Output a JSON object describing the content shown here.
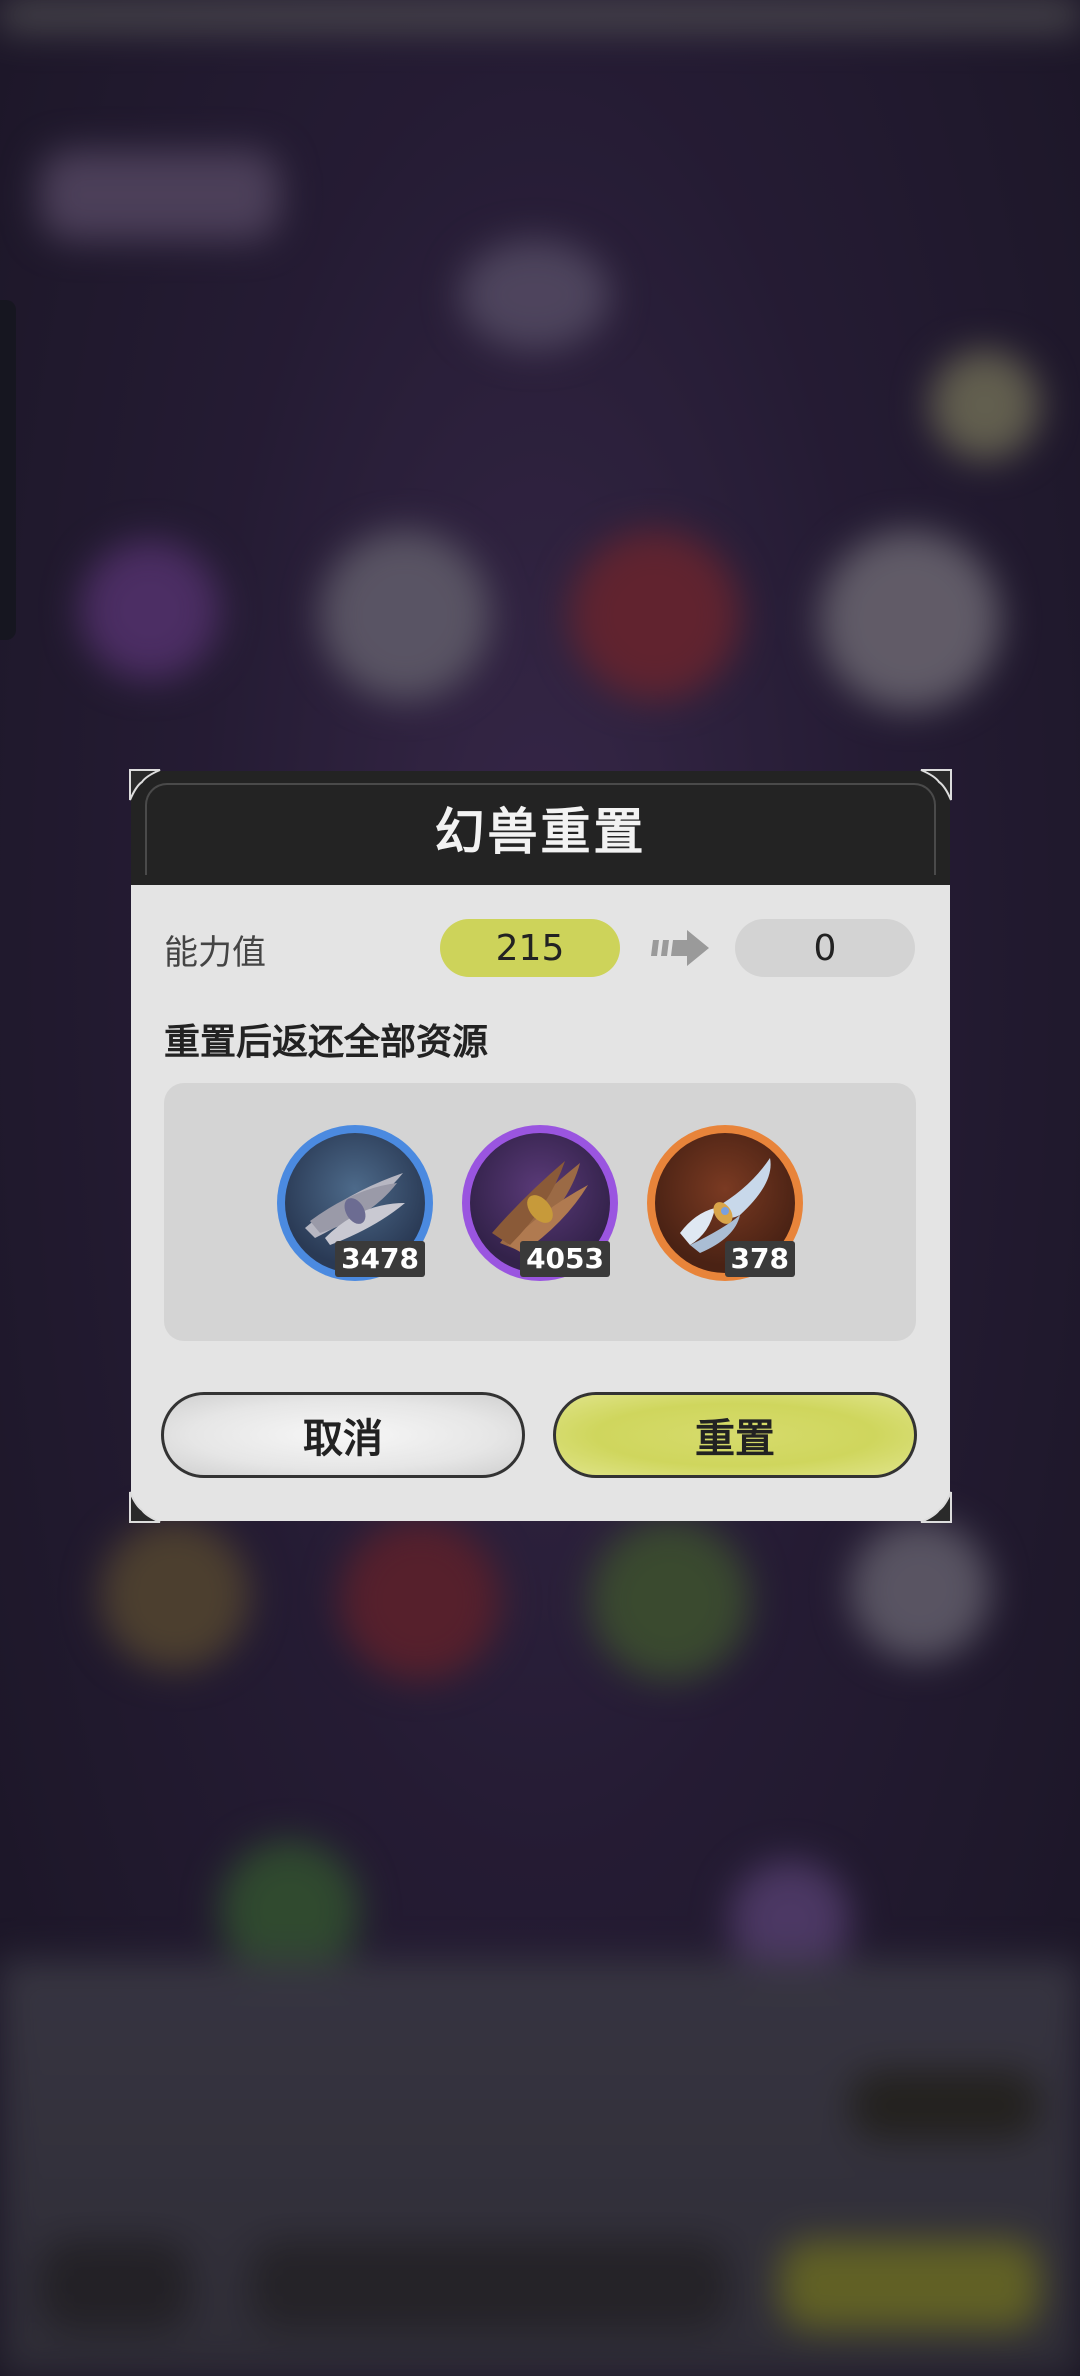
{
  "dialog": {
    "title": "幻兽重置",
    "stat_label": "能力值",
    "stat_before": "215",
    "stat_after": "0",
    "refund_text": "重置后返还全部资源",
    "items": [
      {
        "name": "gray-feather-bundle",
        "quantity": "3478",
        "ring_color": "#4b8ae0"
      },
      {
        "name": "brown-fiber-bundle",
        "quantity": "4053",
        "ring_color": "#9a55e0"
      },
      {
        "name": "white-cloth-roll",
        "quantity": "378",
        "ring_color": "#e8843a"
      }
    ],
    "cancel_label": "取消",
    "confirm_label": "重置"
  },
  "colors": {
    "accent": "#cdd35a",
    "header": "#232323",
    "body": "#e4e4e4"
  }
}
